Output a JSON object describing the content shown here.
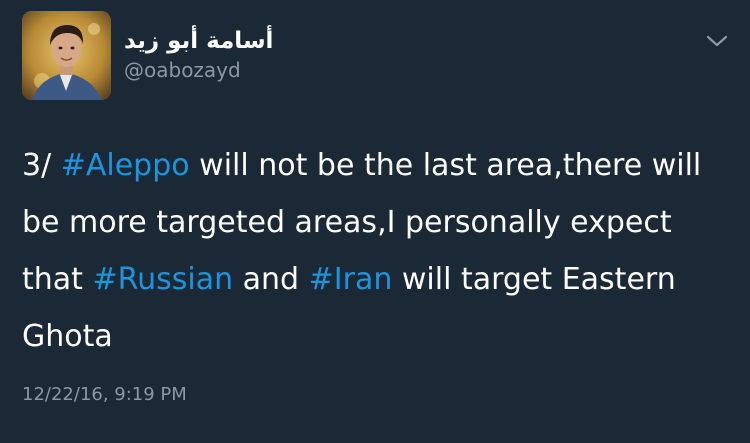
{
  "user": {
    "display_name": "أسامة أبو زيد",
    "handle": "@oabozayd"
  },
  "tweet": {
    "part1": "3/ ",
    "hashtag1": "#Aleppo",
    "part2": " will not be the last area,there will be more targeted areas,I personally expect that ",
    "hashtag2": "#Russian",
    "part3": " and ",
    "hashtag3": "#Iran",
    "part4": " will target Eastern Ghota"
  },
  "timestamp": "12/22/16, 9:19 PM",
  "icons": {
    "menu": "chevron-down-icon",
    "avatar": "profile-photo"
  },
  "colors": {
    "background": "#1b2836",
    "text": "#ffffff",
    "secondary_text": "#8899a6",
    "hashtag": "#1b95e0"
  }
}
